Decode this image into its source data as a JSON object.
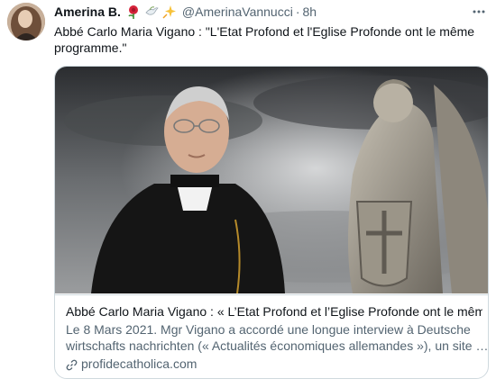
{
  "tweet": {
    "author_name": "Amerina B.",
    "emojis": [
      "rose-icon",
      "dove-icon",
      "sparkle-star-icon"
    ],
    "handle": "@AmerinaVannucci",
    "separator": "·",
    "time": "8h",
    "text": "Abbé Carlo Maria Vigano : \"L'Etat Profond et l'Eglise Profonde ont le même programme.\""
  },
  "card": {
    "title": "Abbé Carlo Maria Vigano : « L’Etat Profond et l’Eglise Profonde ont le même…",
    "description_line1": "Le 8 Mars 2021. Mgr Vigano a accordé une longue interview à Deutsche",
    "description_line2": "wirtschafts nachrichten (« Actualités économiques allemandes »), un site …",
    "domain": "profidecatholica.com"
  },
  "colors": {
    "primary_text": "#0f1419",
    "secondary_text": "#536471",
    "border": "#cfd9de",
    "background": "#ffffff"
  }
}
